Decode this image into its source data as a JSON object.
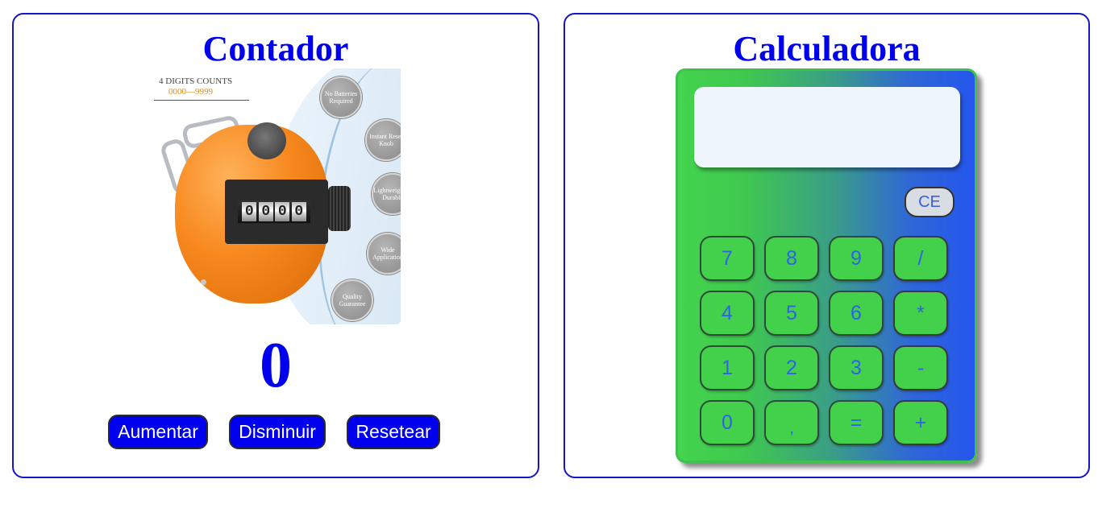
{
  "counter": {
    "title": "Contador",
    "image": {
      "headline": "4 DIGITS COUNTS",
      "range": "0000—9999",
      "digits": [
        "0",
        "0",
        "0",
        "0"
      ],
      "badges": [
        "No Batteries Required",
        "Instant Reset Knob",
        "Lightweight & Durable",
        "Wide Application",
        "Quality Guarantee"
      ]
    },
    "value": "0",
    "buttons": {
      "increase": "Aumentar",
      "decrease": "Disminuir",
      "reset": "Resetear"
    }
  },
  "calculator": {
    "title": "Calculadora",
    "display": "",
    "clear_label": "CE",
    "keys": [
      "7",
      "8",
      "9",
      "/",
      "4",
      "5",
      "6",
      "*",
      "1",
      "2",
      "3",
      "-",
      "0",
      ",",
      "=",
      "+"
    ]
  },
  "colors": {
    "accent": "#0000ee",
    "border": "#1515c8",
    "key_green": "#43d04b",
    "key_text_blue": "#2f63e6",
    "counter_orange": "#f7881e"
  }
}
